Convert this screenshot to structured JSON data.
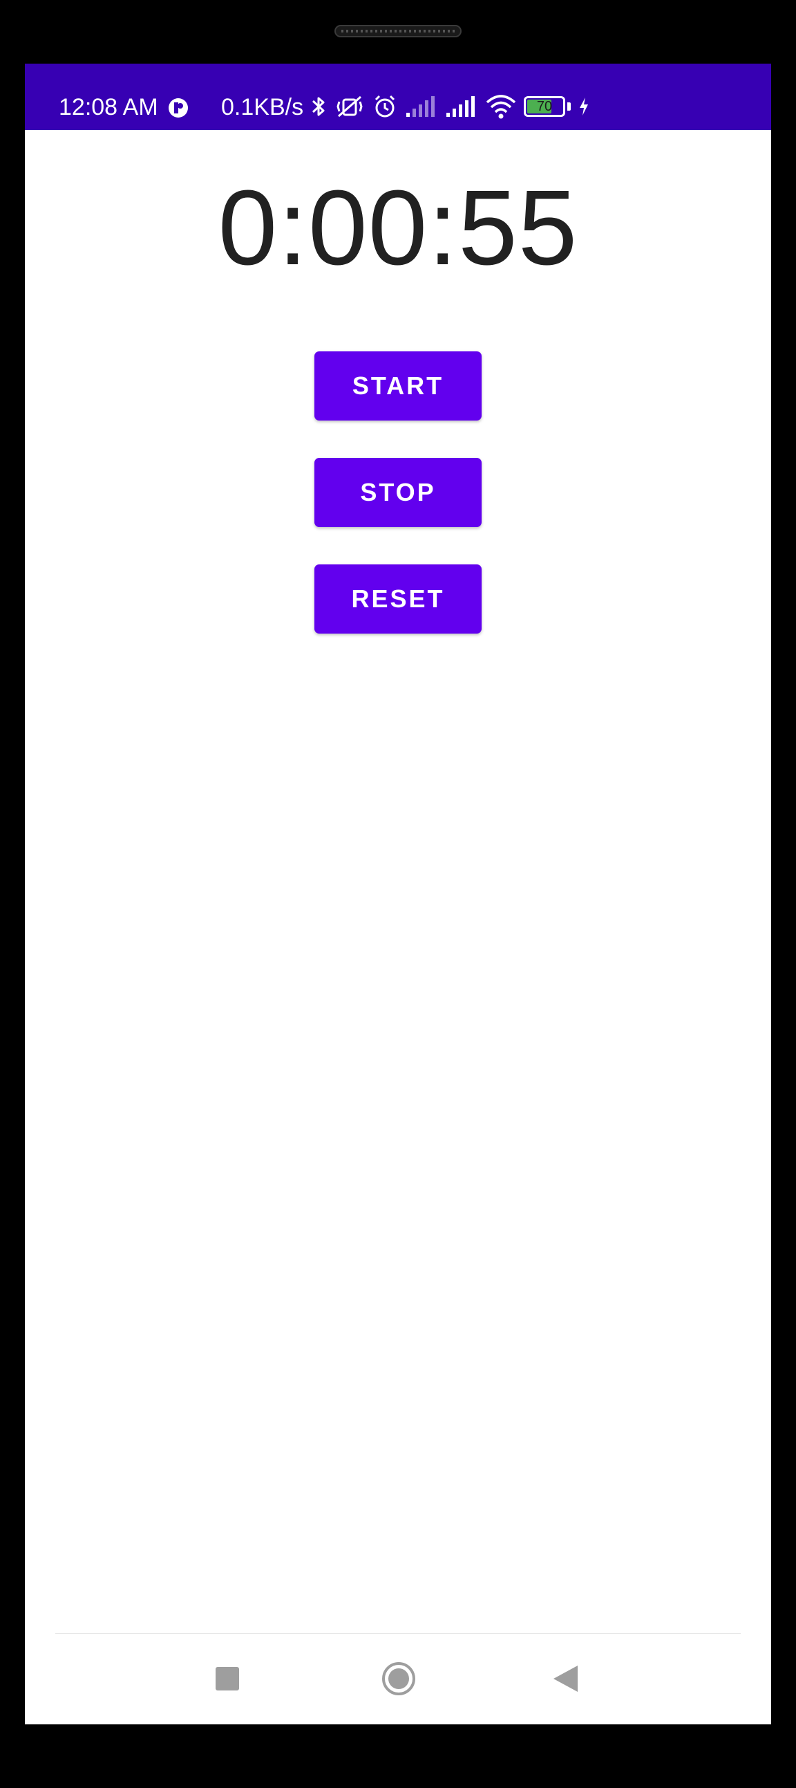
{
  "status_bar": {
    "time": "12:08 AM",
    "network_speed": "0.1KB/s",
    "battery_level": "70",
    "background_color": "#3700b3",
    "icons": [
      "app-notification-icon",
      "bluetooth-icon",
      "vibrate-off-icon",
      "alarm-icon",
      "signal-weak-icon",
      "signal-full-icon",
      "wifi-icon",
      "battery-icon",
      "charging-icon"
    ]
  },
  "timer": {
    "display": "0:00:55"
  },
  "buttons": {
    "start_label": "START",
    "stop_label": "STOP",
    "reset_label": "RESET",
    "color": "#6200ee"
  },
  "nav_bar": {
    "icons": [
      "recents-square-icon",
      "home-circle-icon",
      "back-triangle-icon"
    ]
  }
}
